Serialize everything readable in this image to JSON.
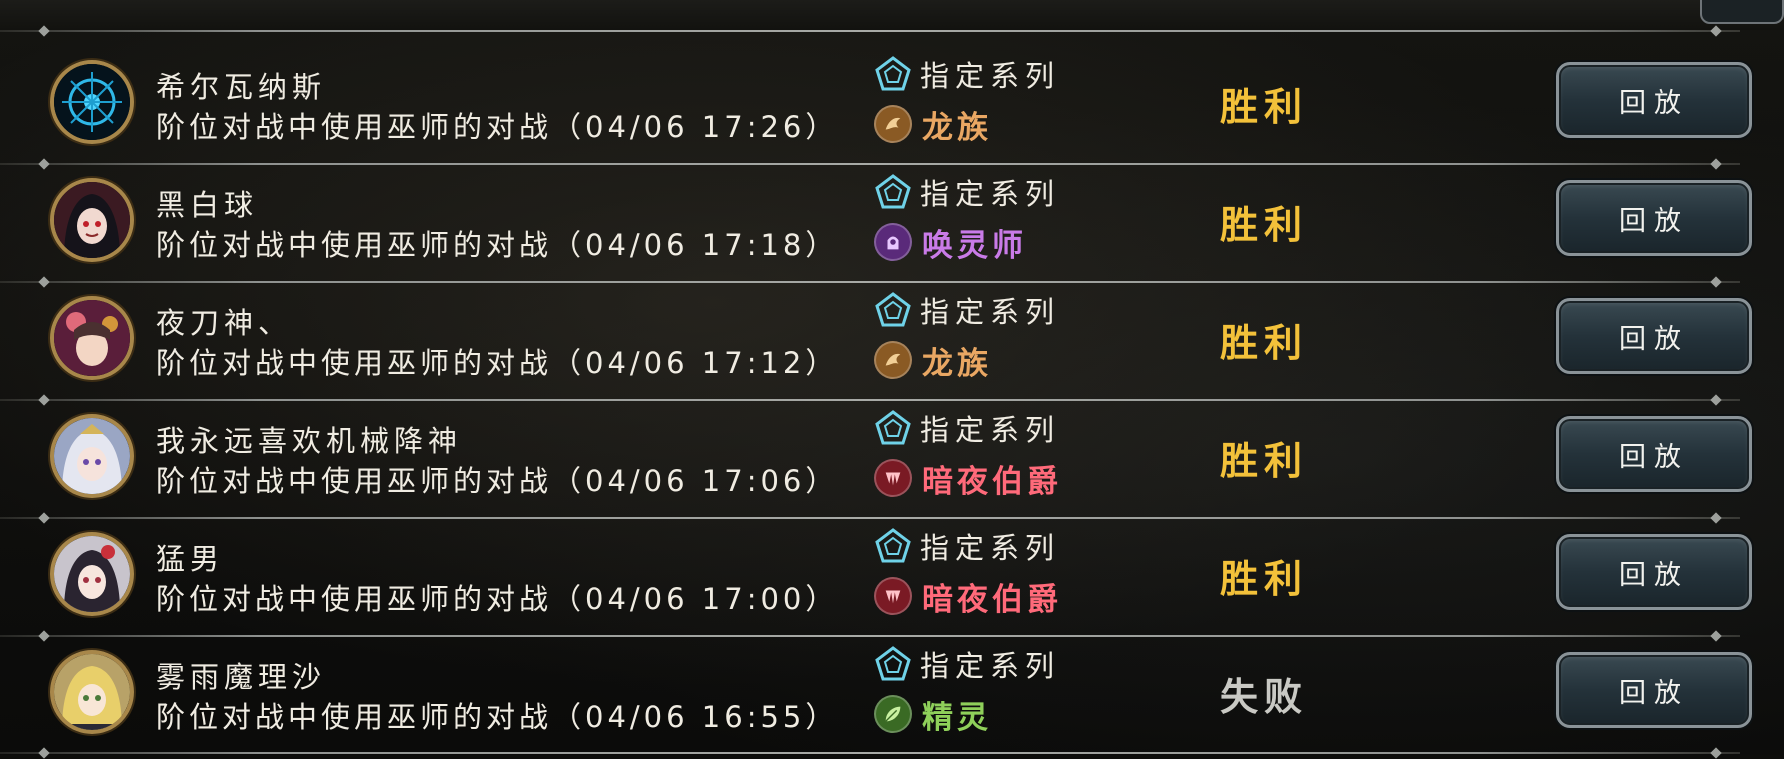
{
  "format_label": "指定系列",
  "replay_label": "回放",
  "colors": {
    "win": "#f3c13a",
    "loss": "#c9c9c4",
    "dragon": "#e9a763",
    "necro": "#c97be8",
    "vampire": "#ff6a7a",
    "forest": "#8fd05a"
  },
  "matches": [
    {
      "player": "希尔瓦纳斯",
      "description": "阶位对战中使用巫师的对战（04/06 17:26）",
      "class_name": "龙族",
      "class_icon": "dragon-icon",
      "result": "胜利"
    },
    {
      "player": "黑白球",
      "description": "阶位对战中使用巫师的对战（04/06 17:18）",
      "class_name": "唤灵师",
      "class_icon": "necromancer-icon",
      "result": "胜利"
    },
    {
      "player": "夜刀神、",
      "description": "阶位对战中使用巫师的对战（04/06 17:12）",
      "class_name": "龙族",
      "class_icon": "dragon-icon",
      "result": "胜利"
    },
    {
      "player": "我永远喜欢机械降神",
      "description": "阶位对战中使用巫师的对战（04/06 17:06）",
      "class_name": "暗夜伯爵",
      "class_icon": "vampire-icon",
      "result": "胜利"
    },
    {
      "player": "猛男",
      "description": "阶位对战中使用巫师的对战（04/06 17:00）",
      "class_name": "暗夜伯爵",
      "class_icon": "vampire-icon",
      "result": "胜利"
    },
    {
      "player": "雾雨魔理沙",
      "description": "阶位对战中使用巫师的对战（04/06 16:55）",
      "class_name": "精灵",
      "class_icon": "forest-icon",
      "result": "失败"
    }
  ]
}
